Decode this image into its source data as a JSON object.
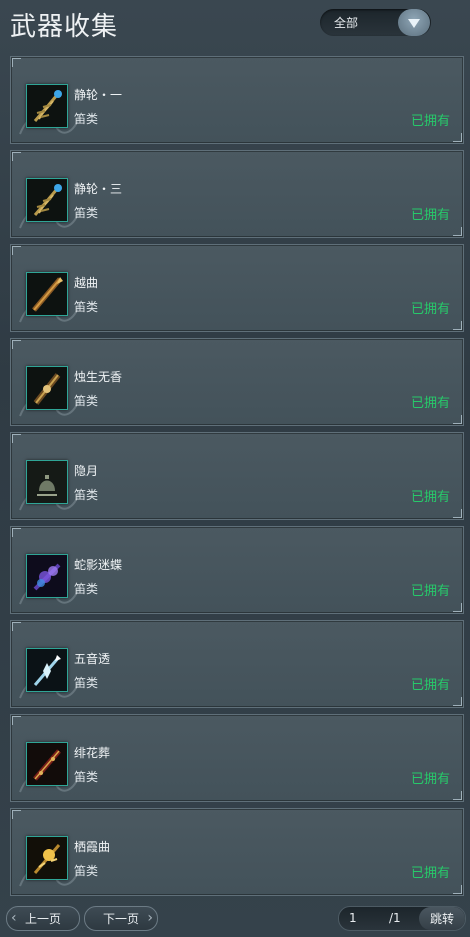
{
  "title": "武器收集",
  "filter": {
    "selected": "全部"
  },
  "items": [
    {
      "name": "静轮・一",
      "type": "笛类",
      "status": "已拥有",
      "icon": "weapon-golden-claw-icon"
    },
    {
      "name": "静轮・三",
      "type": "笛类",
      "status": "已拥有",
      "icon": "weapon-golden-claw-icon"
    },
    {
      "name": "越曲",
      "type": "笛类",
      "status": "已拥有",
      "icon": "weapon-bronze-flute-icon"
    },
    {
      "name": "烛生无香",
      "type": "笛类",
      "status": "已拥有",
      "icon": "weapon-gold-flute-icon"
    },
    {
      "name": "隐月",
      "type": "笛类",
      "status": "已拥有",
      "icon": "weapon-bell-icon"
    },
    {
      "name": "蛇影迷蝶",
      "type": "笛类",
      "status": "已拥有",
      "icon": "weapon-purple-butterfly-icon"
    },
    {
      "name": "五音透",
      "type": "笛类",
      "status": "已拥有",
      "icon": "weapon-crystal-flute-icon"
    },
    {
      "name": "绯花葬",
      "type": "笛类",
      "status": "已拥有",
      "icon": "weapon-red-flute-icon"
    },
    {
      "name": "栖霞曲",
      "type": "笛类",
      "status": "已拥有",
      "icon": "weapon-golden-sun-icon"
    }
  ],
  "pager": {
    "prev_label": "上一页",
    "next_label": "下一页",
    "current_page": "1",
    "total_pages": "/1",
    "jump_label": "跳转"
  }
}
